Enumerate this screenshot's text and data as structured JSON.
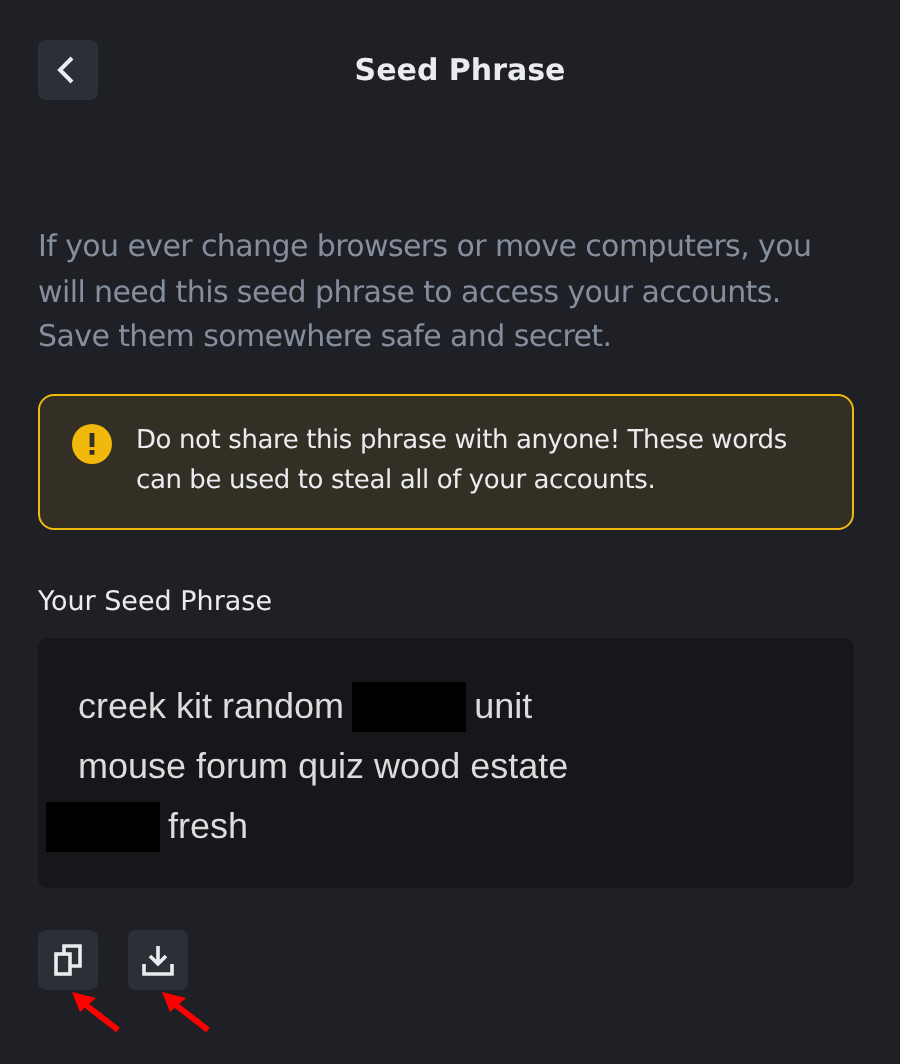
{
  "header": {
    "back_icon": true,
    "title": "Seed Phrase"
  },
  "description": "If you ever change browsers or move computers, you will need this seed phrase to access your accounts. Save them somewhere safe and secret.",
  "warning": {
    "text": "Do not share this phrase with anyone! These words can be used to steal all of your accounts."
  },
  "seed_label": "Your Seed Phrase",
  "seed_lines": [
    [
      {
        "kind": "text",
        "text": "creek kit random"
      },
      {
        "kind": "redacted"
      },
      {
        "kind": "text",
        "text": "unit"
      }
    ],
    [
      {
        "kind": "text",
        "text": "mouse forum quiz wood estate"
      }
    ],
    [
      {
        "kind": "redacted"
      },
      {
        "kind": "text",
        "text": "fresh"
      }
    ]
  ],
  "actions": [
    {
      "kind": "copy",
      "arrow": true
    },
    {
      "kind": "download",
      "arrow": true
    }
  ]
}
